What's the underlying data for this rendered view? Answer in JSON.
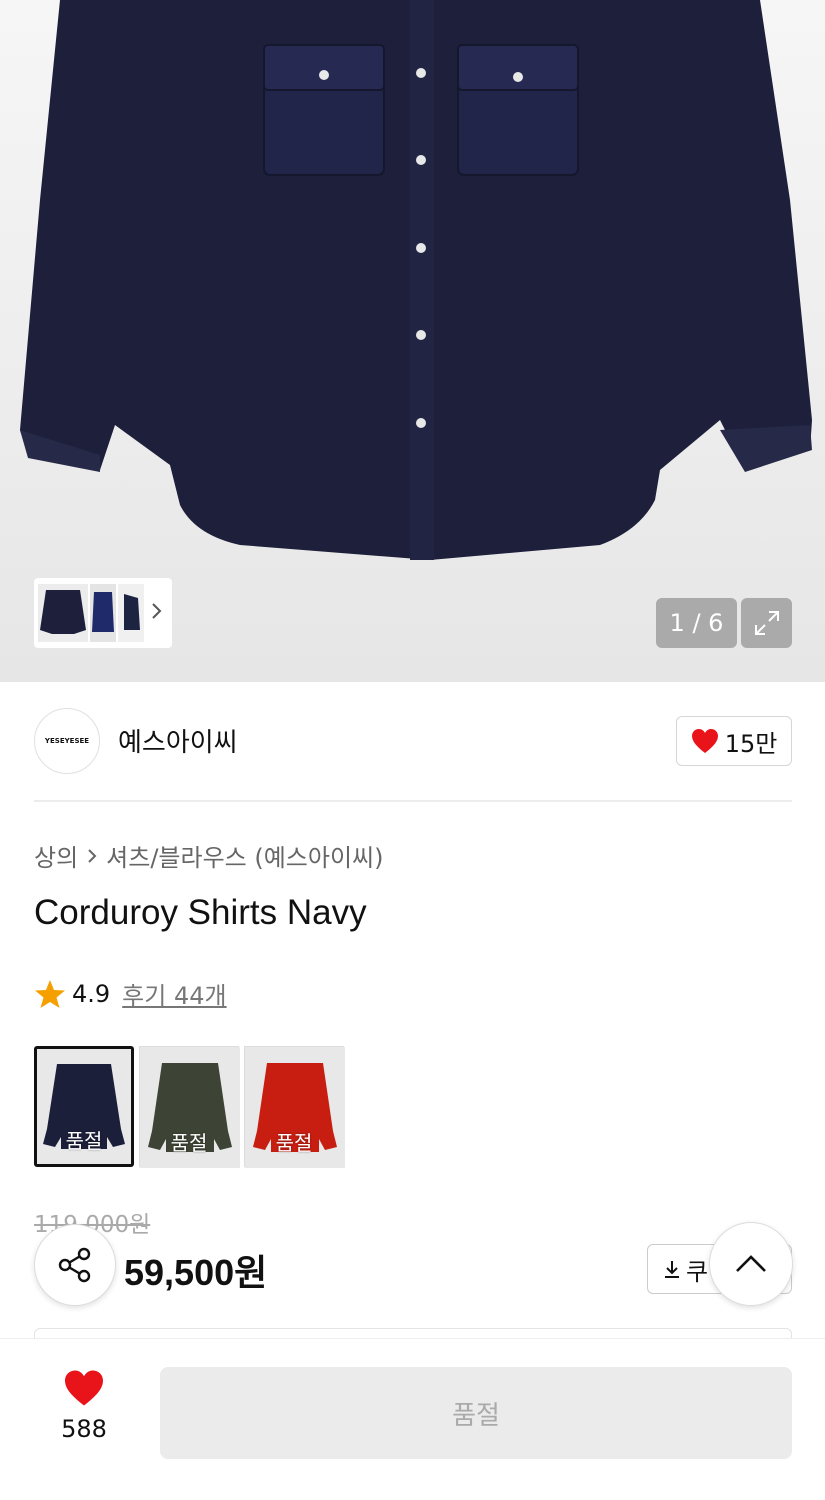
{
  "gallery": {
    "counter": "1 / 6",
    "thumbnail_count": 3
  },
  "brand": {
    "logo_text": "YESEYESEE",
    "name": "예스아이씨",
    "likes": "15만"
  },
  "breadcrumb": {
    "category": "상의",
    "subcategory": "셔츠/블라우스 (예스아이씨)"
  },
  "product": {
    "title": "Corduroy Shirts Navy",
    "rating": "4.9",
    "reviews_label": "후기 44개",
    "original_price": "119,000원",
    "sale_price": "59,500원",
    "coupon_label": "쿠"
  },
  "color_options": [
    {
      "label": "품절",
      "color": "#1c1f3a",
      "selected": true
    },
    {
      "label": "품절",
      "color": "#3e4435",
      "selected": false
    },
    {
      "label": "품절",
      "color": "#c81e12",
      "selected": false
    }
  ],
  "bottom_bar": {
    "wish_count": "588",
    "buy_label": "품절"
  },
  "colors": {
    "shirt_navy": "#1d1f3b",
    "heart_red": "#e8141a",
    "star_orange": "#f5a000"
  }
}
